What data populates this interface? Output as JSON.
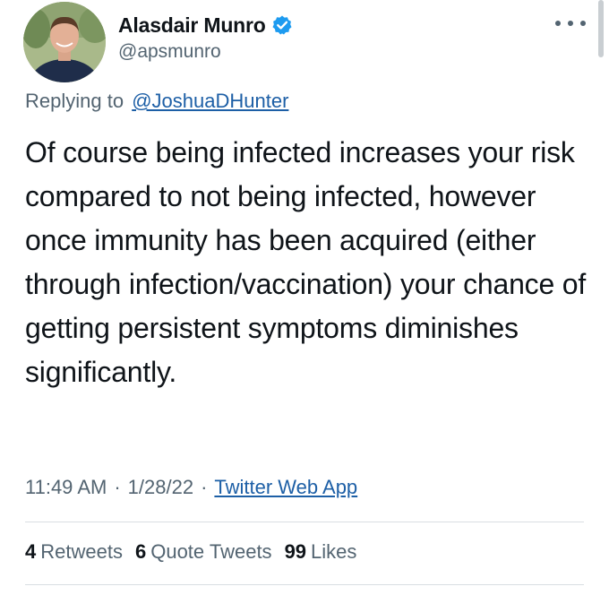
{
  "tweet": {
    "author": {
      "display_name": "Alasdair Munro",
      "handle": "@apsmunro",
      "verified": true
    },
    "reply": {
      "prefix": "Replying to",
      "to_handle": "@JoshuaDHunter"
    },
    "text": "Of course being infected increases your risk compared to not being infected, however once immunity has been acquired (either through infection/vaccination) your chance of getting persistent symptoms diminishes significantly.",
    "time": "11:49 AM",
    "date": "1/28/22",
    "source": "Twitter Web App",
    "separator": "·",
    "stats": [
      {
        "count": "4",
        "label": "Retweets"
      },
      {
        "count": "6",
        "label": "Quote Tweets"
      },
      {
        "count": "99",
        "label": "Likes"
      }
    ]
  },
  "icons": {
    "verified": "verified-badge-icon",
    "more": "more-options-icon"
  },
  "colors": {
    "verified_blue": "#1d9bf0",
    "link_blue": "#1d5fa6",
    "secondary_text": "#536471",
    "primary_text": "#0f1419"
  }
}
